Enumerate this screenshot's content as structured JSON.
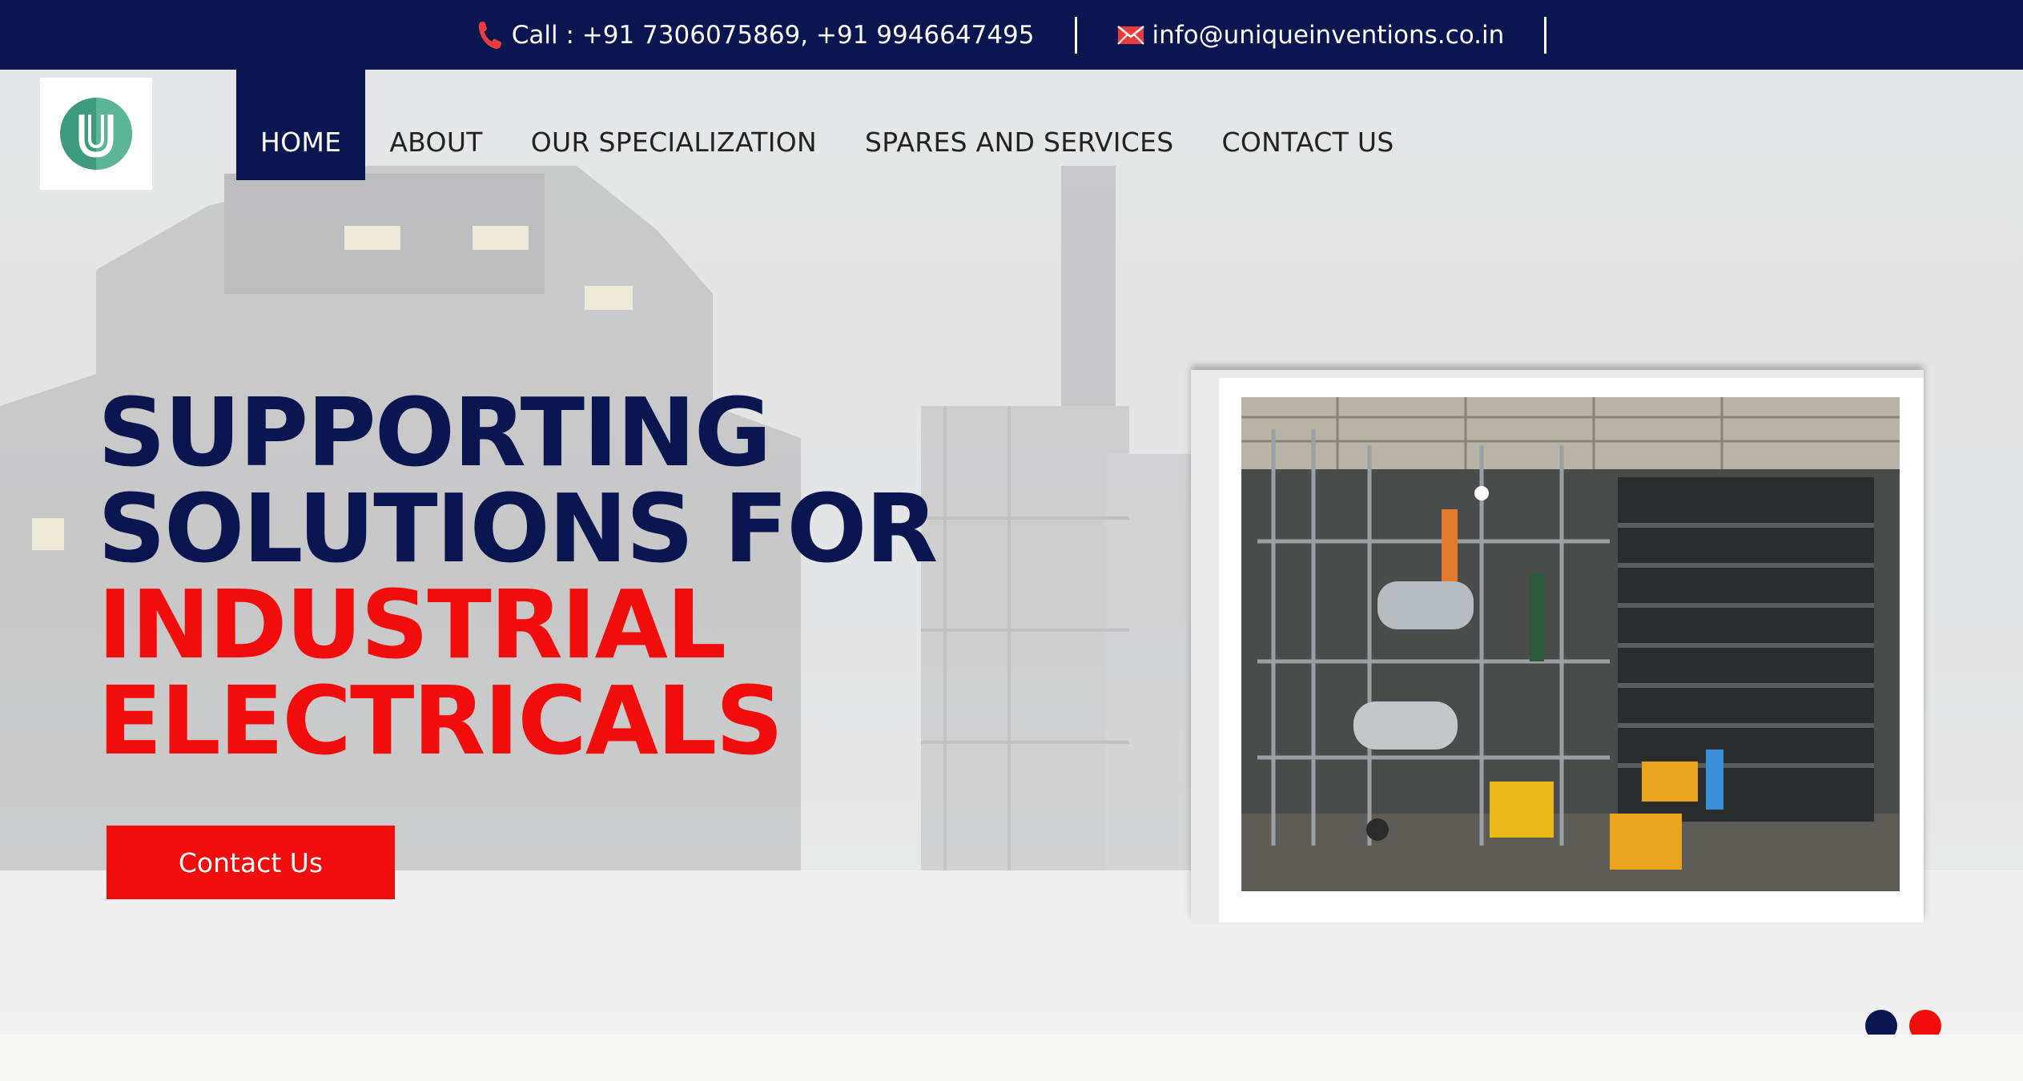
{
  "topbar": {
    "phone_text": "Call : +91 7306075869, +91 9946647495",
    "email_text": "info@uniqueinventions.co.in"
  },
  "nav": {
    "items": [
      {
        "label": "HOME",
        "active": true
      },
      {
        "label": "ABOUT",
        "active": false
      },
      {
        "label": "OUR SPECIALIZATION",
        "active": false
      },
      {
        "label": "SPARES AND SERVICES",
        "active": false
      },
      {
        "label": "CONTACT US",
        "active": false
      }
    ]
  },
  "hero": {
    "line1": "SUPPORTING",
    "line2": "SOLUTIONS FOR",
    "line3": "INDUSTRIAL",
    "line4": "ELECTRICALS",
    "cta_label": "Contact Us"
  },
  "slider": {
    "count": 2,
    "active_index": 0
  },
  "colors": {
    "navy": "#0b1650",
    "red": "#f20d0d",
    "logo_green": "#3f9b7d"
  },
  "icons": {
    "phone": "phone-icon",
    "mail": "mail-icon",
    "logo": "logo-icon"
  }
}
